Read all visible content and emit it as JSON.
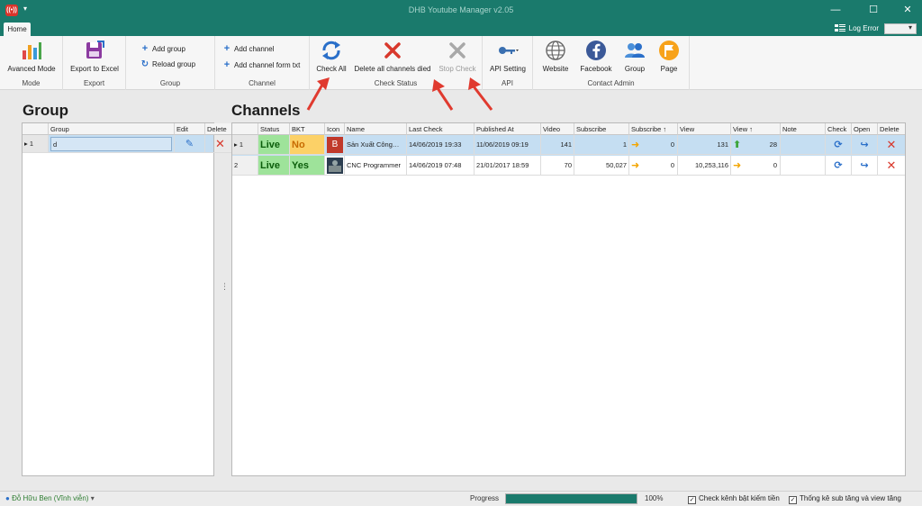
{
  "window": {
    "title": "DHB Youtube Manager v2.05",
    "minimize": "—",
    "maximize": "☐",
    "close": "✕"
  },
  "tabs": {
    "home": "Home"
  },
  "topright": {
    "log_error": "Log Error"
  },
  "ribbon": {
    "mode": {
      "advanced_mode": "Avanced Mode",
      "label": "Mode"
    },
    "export": {
      "export_excel": "Export to Excel",
      "label": "Export"
    },
    "group": {
      "add_group": "Add group",
      "reload_group": "Reload group",
      "label": "Group"
    },
    "channel": {
      "add_channel": "Add channel",
      "add_channel_txt": "Add channel form txt",
      "label": "Channel"
    },
    "check_status": {
      "check_all": "Check All",
      "delete_died": "Delete all channels died",
      "stop_check": "Stop Check",
      "label": "Check Status"
    },
    "api": {
      "api_setting": "API Setting",
      "label": "API"
    },
    "contact": {
      "website": "Website",
      "facebook": "Facebook",
      "group": "Group",
      "page": "Page",
      "label": "Contact Admin"
    }
  },
  "group_panel": {
    "title": "Group",
    "columns": [
      "Group",
      "Edit",
      "Delete"
    ],
    "rows": [
      {
        "index": "1",
        "group": "d"
      }
    ]
  },
  "channels_panel": {
    "title": "Channels",
    "columns": [
      "Status",
      "BKT",
      "Icon",
      "Name",
      "Last Check",
      "Published At",
      "Video",
      "Subscribe",
      "Subscribe ↑",
      "View",
      "View ↑",
      "Note",
      "Check",
      "Open",
      "Delete"
    ],
    "rows": [
      {
        "index": "1",
        "status": "Live",
        "bkt": "No",
        "icon_letter": "B",
        "name": "Sản Xuất Công…",
        "last_check": "14/06/2019 19:33",
        "published_at": "11/06/2019 09:19",
        "video": "141",
        "subscribe": "1",
        "subscribe_up": "0",
        "view": "131",
        "view_up": "28",
        "note": ""
      },
      {
        "index": "2",
        "status": "Live",
        "bkt": "Yes",
        "icon_letter": "",
        "name": "CNC Programmer",
        "last_check": "14/06/2019 07:48",
        "published_at": "21/01/2017 18:59",
        "video": "70",
        "subscribe": "50,027",
        "subscribe_up": "0",
        "view": "10,253,116",
        "view_up": "0",
        "note": ""
      }
    ]
  },
  "statusbar": {
    "user": "Đỗ Hữu Ben (Vĩnh viễn)",
    "progress_label": "Progress",
    "progress_value": 1.0,
    "progress_pct": "100%",
    "check_kenh": "Check kênh bật kiếm tiền",
    "thong_ke": "Thống kê sub tăng và view tăng"
  },
  "colors": {
    "title_bar": "#1a7a6c",
    "live": "#9ee39a",
    "bkt_no": "#fcd167",
    "selected_row": "#c5def2",
    "annotation_arrow": "#e03a2f"
  }
}
